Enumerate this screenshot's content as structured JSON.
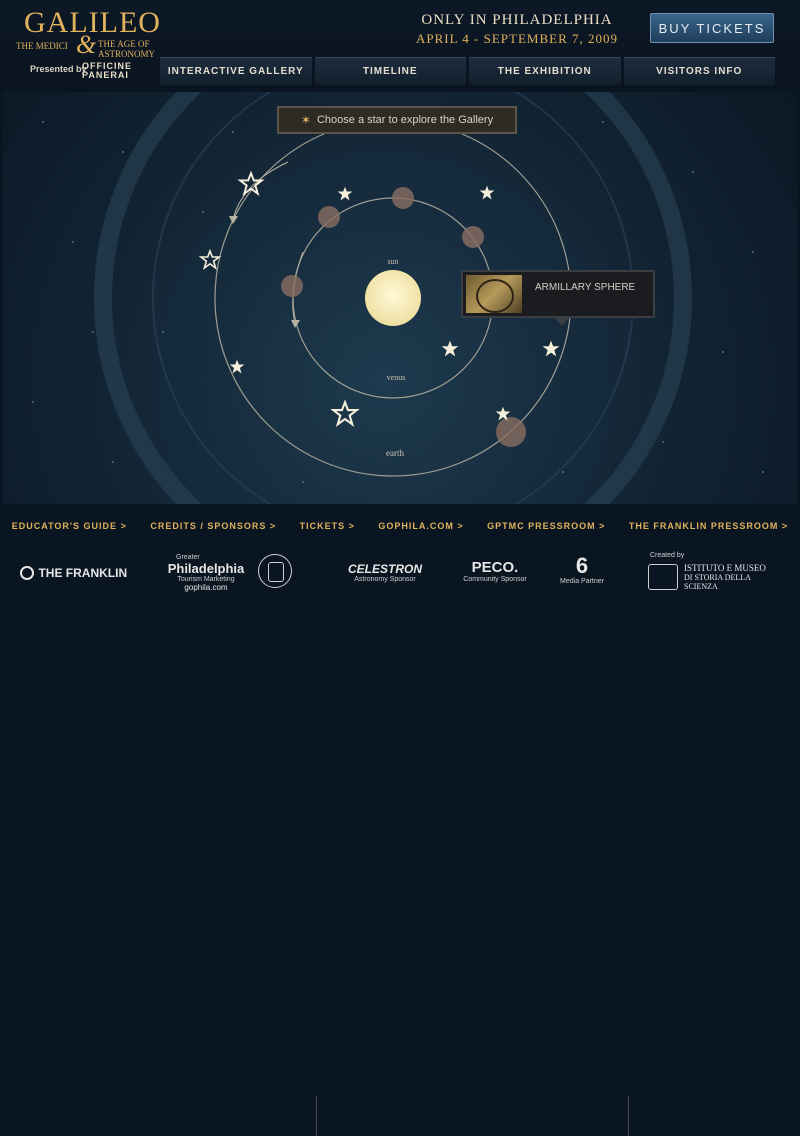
{
  "header": {
    "logo": {
      "word": "GALILEO",
      "line1": "THE MEDICI",
      "amp": "&",
      "line2a": "THE AGE OF",
      "line2b": "ASTRONOMY"
    },
    "promo": {
      "line1": "ONLY IN PHILADELPHIA",
      "line2": "APRIL 4 - SEPTEMBER 7, 2009"
    },
    "buy_tickets": "BUY TICKETS",
    "presented_by": "Presented by",
    "sponsor": {
      "line1": "OFFICINE",
      "line2": "PANERAI"
    },
    "nav": [
      {
        "label": "INTERACTIVE GALLERY"
      },
      {
        "label": "TIMELINE"
      },
      {
        "label": "THE EXHIBITION"
      },
      {
        "label": "VISITORS INFO"
      }
    ]
  },
  "gallery": {
    "prompt": "Choose a star to explore the Gallery",
    "orbit_labels": {
      "sun": "sun",
      "venus": "venus",
      "earth": "earth"
    },
    "tooltip": {
      "label": "ARMILLARY SPHERE"
    }
  },
  "footer": {
    "links": [
      {
        "label": "EDUCATOR'S GUIDE  >"
      },
      {
        "label": "CREDITS / SPONSORS  >"
      },
      {
        "label": "TICKETS  >"
      },
      {
        "label": "GOPHILA.COM  >"
      },
      {
        "label": "GPTMC PRESSROOM  >"
      },
      {
        "label": "THE FRANKLIN PRESSROOM  >"
      }
    ],
    "sponsors": {
      "franklin": "THE FRANKLIN",
      "gophila": {
        "top": "Greater",
        "name": "Philadelphia",
        "sub": "Tourism Marketing",
        "url": "gophila.com"
      },
      "celestron": {
        "name": "CELESTRON",
        "caption": "Astronomy Sponsor"
      },
      "peco": {
        "name": "PECO.",
        "caption": "Community Sponsor"
      },
      "media": {
        "name": "6",
        "caption": "Media Partner"
      },
      "istituto": {
        "created": "Created by",
        "line1": "ISTITUTO E MUSEO",
        "line2": "DI STORIA DELLA SCIENZA"
      }
    }
  },
  "colors": {
    "gold": "#e0b25b",
    "button_blue": "#2d5577",
    "bg_dark": "#0a1522"
  }
}
